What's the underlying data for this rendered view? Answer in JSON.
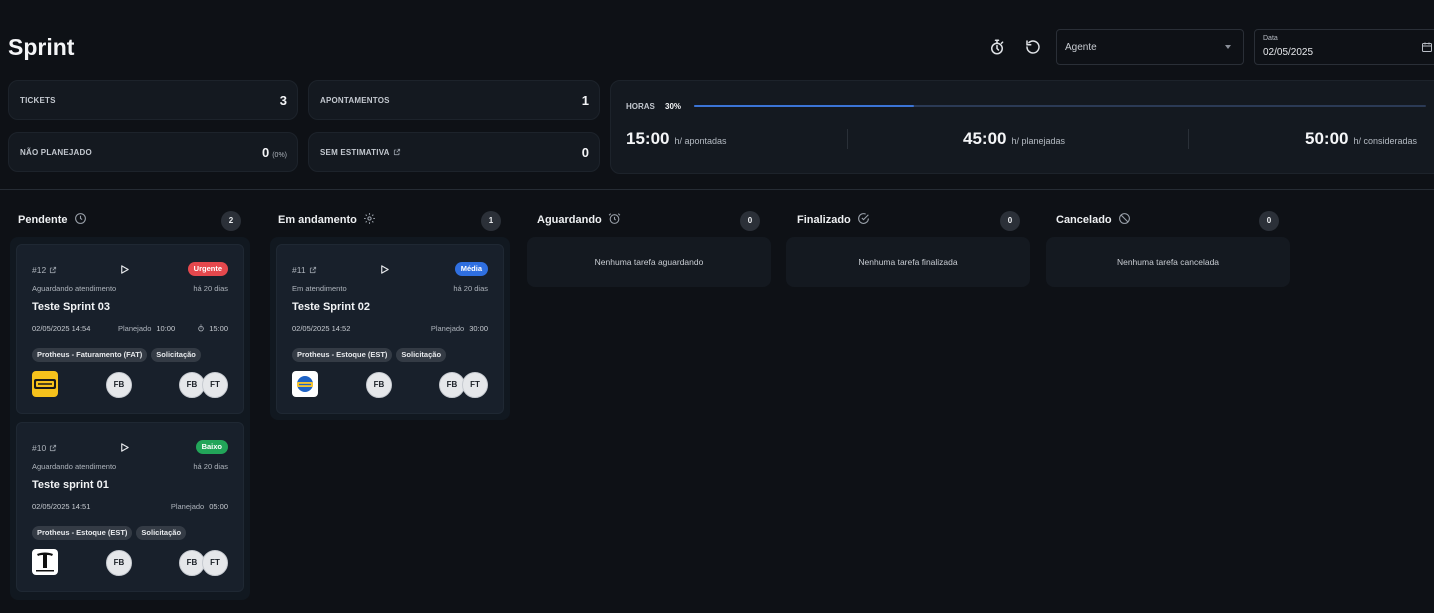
{
  "header": {
    "title": "Sprint",
    "timer_icon": "stopwatch-icon",
    "reset_icon": "reset-icon",
    "agent_placeholder": "Agente",
    "date_label": "Data",
    "date_value": "02/05/2025"
  },
  "stats": {
    "tickets_label": "TICKETS",
    "tickets_value": "3",
    "apontamentos_label": "APONTAMENTOS",
    "apontamentos_value": "1",
    "nao_planejado_label": "NÃO PLANEJADO",
    "nao_planejado_value": "0",
    "nao_planejado_pct": "(0%)",
    "sem_estimativa_label": "SEM ESTIMATIVA",
    "sem_estimativa_value": "0"
  },
  "hours": {
    "label": "HORAS",
    "percent_text": "30%",
    "progress": 0.3,
    "apontadas_value": "15:00",
    "apontadas_label": "h/ apontadas",
    "planejadas_value": "45:00",
    "planejadas_label": "h/ planejadas",
    "consideradas_value": "50:00",
    "consideradas_label": "h/ consideradas"
  },
  "columns": [
    {
      "title": "Pendente",
      "icon": "clock-icon",
      "count": "2"
    },
    {
      "title": "Em andamento",
      "icon": "gear-icon",
      "count": "1"
    },
    {
      "title": "Aguardando",
      "icon": "alarm-icon",
      "count": "0",
      "empty": "Nenhuma tarefa aguardando"
    },
    {
      "title": "Finalizado",
      "icon": "check-circle-icon",
      "count": "0",
      "empty": "Nenhuma tarefa finalizada"
    },
    {
      "title": "Cancelado",
      "icon": "ban-icon",
      "count": "0",
      "empty": "Nenhuma tarefa cancelada"
    }
  ],
  "cards": [
    {
      "id": "#12",
      "priority": "Urgente",
      "priority_color": "#e5484d",
      "status": "Aguardando atendimento",
      "ago": "há 20 dias",
      "title": "Teste Sprint 03",
      "date": "02/05/2025 14:54",
      "planned_label": "Planejado",
      "planned_value": "10:00",
      "estimate": "15:00",
      "tags": [
        "Protheus - Faturamento (FAT)",
        "Solicitação"
      ],
      "logo": "sinuelo-logo",
      "avatar_main": "FB",
      "avatars": [
        "FB",
        "FT"
      ]
    },
    {
      "id": "#10",
      "priority": "Baixo",
      "priority_color": "#22a559",
      "status": "Aguardando atendimento",
      "ago": "há 20 dias",
      "title": "Teste sprint 01",
      "date": "02/05/2025 14:51",
      "planned_label": "Planejado",
      "planned_value": "05:00",
      "tags": [
        "Protheus - Estoque (EST)",
        "Solicitação"
      ],
      "logo": "tesla-logo",
      "avatar_main": "FB",
      "avatars": [
        "FB",
        "FT"
      ]
    },
    {
      "id": "#11",
      "priority": "Média",
      "priority_color": "#2f6fe0",
      "status": "Em atendimento",
      "ago": "há 20 dias",
      "title": "Teste Sprint 02",
      "date": "02/05/2025 14:52",
      "planned_label": "Planejado",
      "planned_value": "30:00",
      "tags": [
        "Protheus - Estoque (EST)",
        "Solicitação"
      ],
      "logo": "company-logo",
      "avatar_main": "FB",
      "avatars": [
        "FB",
        "FT"
      ]
    }
  ]
}
